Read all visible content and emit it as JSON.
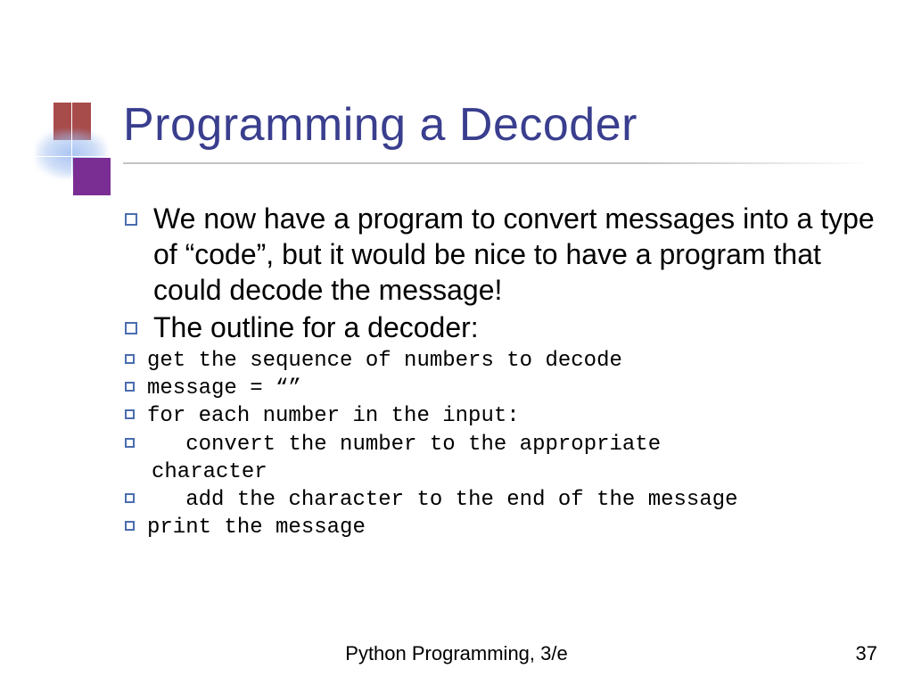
{
  "title": "Programming a Decoder",
  "bullets": {
    "b1": "We now have a program to convert messages into a type of “code”, but it would be nice to have a program that could decode the message!",
    "b2": "The outline for a decoder:"
  },
  "code": {
    "l1": "get the sequence of numbers to decode",
    "l2": "message = “”",
    "l3": "for each number in the input:",
    "l4a": "   convert the number to the appropriate",
    "l4b": "character",
    "l5": "   add the character to the end of the message",
    "l6": "print the message"
  },
  "footer": "Python Programming, 3/e",
  "page": "37"
}
